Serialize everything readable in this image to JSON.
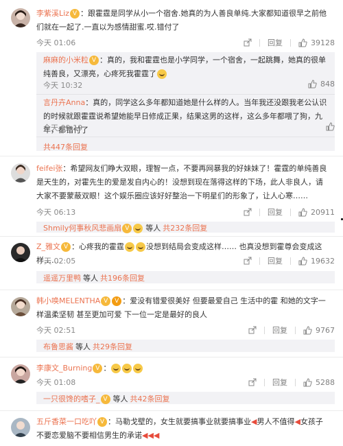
{
  "comments": [
    {
      "user": "李紫溪Liz",
      "text": "：跟霍霆是同学从小一个宿舍.她真的为人善良单纯.大家都知道很早之前他们就在一起了.一直以为感情甜蜜.哎.错付了",
      "time": "今天 01:06",
      "likes": "39128",
      "replies": [
        {
          "user": "麻麻的小米粒",
          "text": "：真的，我和霍霆也是小学同学，一个宿舍，一起跳舞，她真的很单纯善良，又漂亮，心疼死我霍霆了",
          "time": "今天 10:32",
          "likes": "848"
        },
        {
          "user": "言丹卉Anna",
          "text": "：真的，同学这么多年都知道她是什么样的人。当年我还没跟我老公认识的时候就跟霍霆说希望她能早日修成正果，结果这男的这样，这么多年都喂了狗，九年，都错付了",
          "time": "今天 09:19",
          "likes": ""
        }
      ],
      "more": "共447条回复"
    },
    {
      "user": "feifei张",
      "text": "：希望网友们睁大双眼，理智一点，不要再网暴我的好妹妹了！霍霆的单纯善良是天生的，对霍先生的爱是发自内心的！没想到现在落得这样的下场，此人非良人，请大家不要蒙蔽双眼！这个娱乐圈应该好好整治一下明星们的形象了，让人心寒……",
      "time": "今天 06:13",
      "likes": "20911",
      "more_user": "Shmily何事秋风悲画扇",
      "more_mid": "等人",
      "more": "共232条回复"
    },
    {
      "user": "Z_雅文",
      "text": "：心疼我的霍霆",
      "text2": "没想到结局会变成这样…… 也真没想到霍尊会变成这样……",
      "time": "今天 02:05",
      "likes": "19632",
      "more_user": "遥遥万里鸭",
      "more_mid": "等人",
      "more": "共196条回复"
    },
    {
      "user": "韩小唤MELENTHA",
      "text": "：爱没有错爱很美好 但要最爱自己 生活中的霍 和她的文字一样温柔坚韧 甚至更加可爱 下一位一定是最好的良人",
      "time": "今天 02:51",
      "likes": "9767",
      "more_user": "布鲁思酱",
      "more_mid": "等人",
      "more": "共29条回复"
    },
    {
      "user": "李康文_Burning",
      "text": "：",
      "time": "今天 01:08",
      "likes": "5288",
      "more_user": "一只很馋的嗜子_",
      "more_mid": "等人",
      "more": "共42条回复"
    },
    {
      "user": "五斤香菜一口吃吖",
      "text": "：马勒戈壁的，女生就要搞事业就要搞事业",
      "text2": "男人不值得",
      "text3": "女孩子不要恋爱脑不要相信男生的承诺",
      "time": "",
      "likes": ""
    }
  ],
  "labels": {
    "reply": "回复"
  }
}
